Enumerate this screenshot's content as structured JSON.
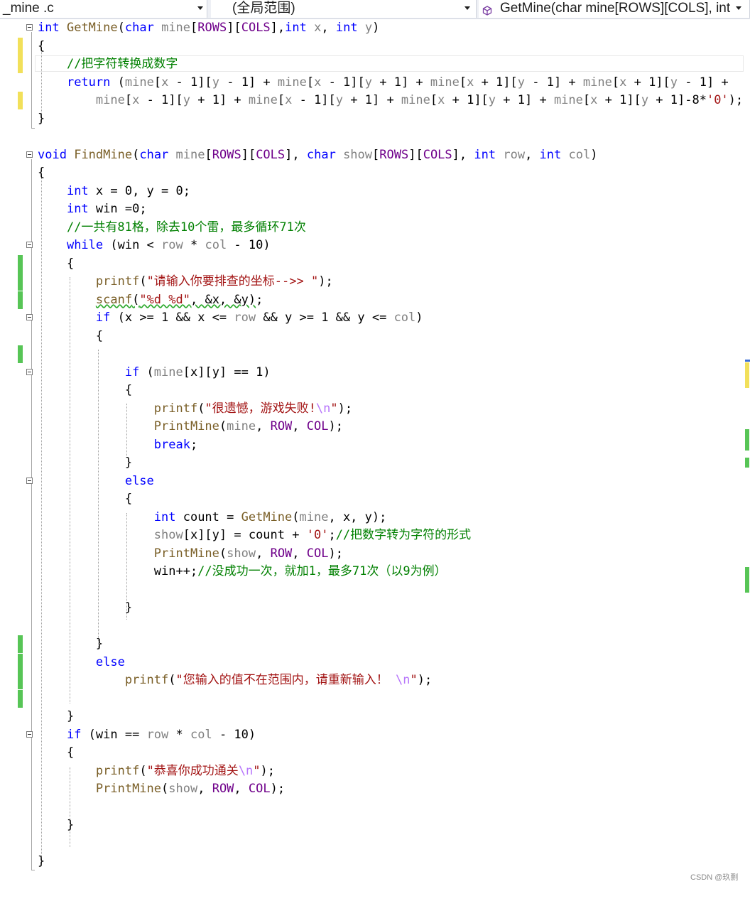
{
  "navbar": {
    "file": "_mine .c",
    "scope": "(全局范围)",
    "member": "GetMine(char mine[ROWS][COLS], int"
  },
  "watermark": "CSDN @玖剽",
  "colors": {
    "keyword": "#0000ff",
    "comment": "#008000",
    "string": "#a31515",
    "macro": "#6f008a",
    "function": "#795e26",
    "parameter": "#808080",
    "change_saved": "#57c556",
    "change_unsaved": "#f2e05a"
  },
  "code_lines": [
    "int GetMine(char mine[ROWS][COLS],int x, int y)",
    "{",
    "    //把字符转换成数字",
    "    return (mine[x - 1][y - 1] + mine[x - 1][y + 1] + mine[x + 1][y - 1] + mine[x + 1][y - 1] +",
    "        mine[x - 1][y + 1] + mine[x - 1][y + 1] + mine[x + 1][y + 1] + mine[x + 1][y + 1]-8*'0');",
    "}",
    "",
    "void FindMine(char mine[ROWS][COLS], char show[ROWS][COLS], int row, int col)",
    "{",
    "    int x = 0, y = 0;",
    "    int win =0;",
    "    //一共有81格，除去10个雷，最多循环71次",
    "    while (win < row * col - 10)",
    "    {",
    "        printf(\"请输入你要排查的坐标-->> \");",
    "        scanf(\"%d %d\", &x, &y);",
    "        if (x >= 1 && x <= row && y >= 1 && y <= col)",
    "        {",
    "",
    "            if (mine[x][y] == 1)",
    "            {",
    "                printf(\"很遗憾，游戏失败!\\n\");",
    "                PrintMine(mine, ROW, COL);",
    "                break;",
    "            }",
    "            else",
    "            {",
    "                int count = GetMine(mine, x, y);",
    "                show[x][y] = count + '0';//把数字转为字符的形式",
    "                PrintMine(show, ROW, COL);",
    "                win++;//没成功一次，就加1，最多71次（以9为例）",
    "",
    "            }",
    "",
    "        }",
    "        else",
    "            printf(\"您输入的值不在范围内，请重新输入！ \\n\");",
    "",
    "    }",
    "    if (win == row * col - 10)",
    "    {",
    "        printf(\"恭喜你成功通关\\n\");",
    "        PrintMine(show, ROW, COL);",
    "",
    "    }",
    "",
    "}"
  ]
}
